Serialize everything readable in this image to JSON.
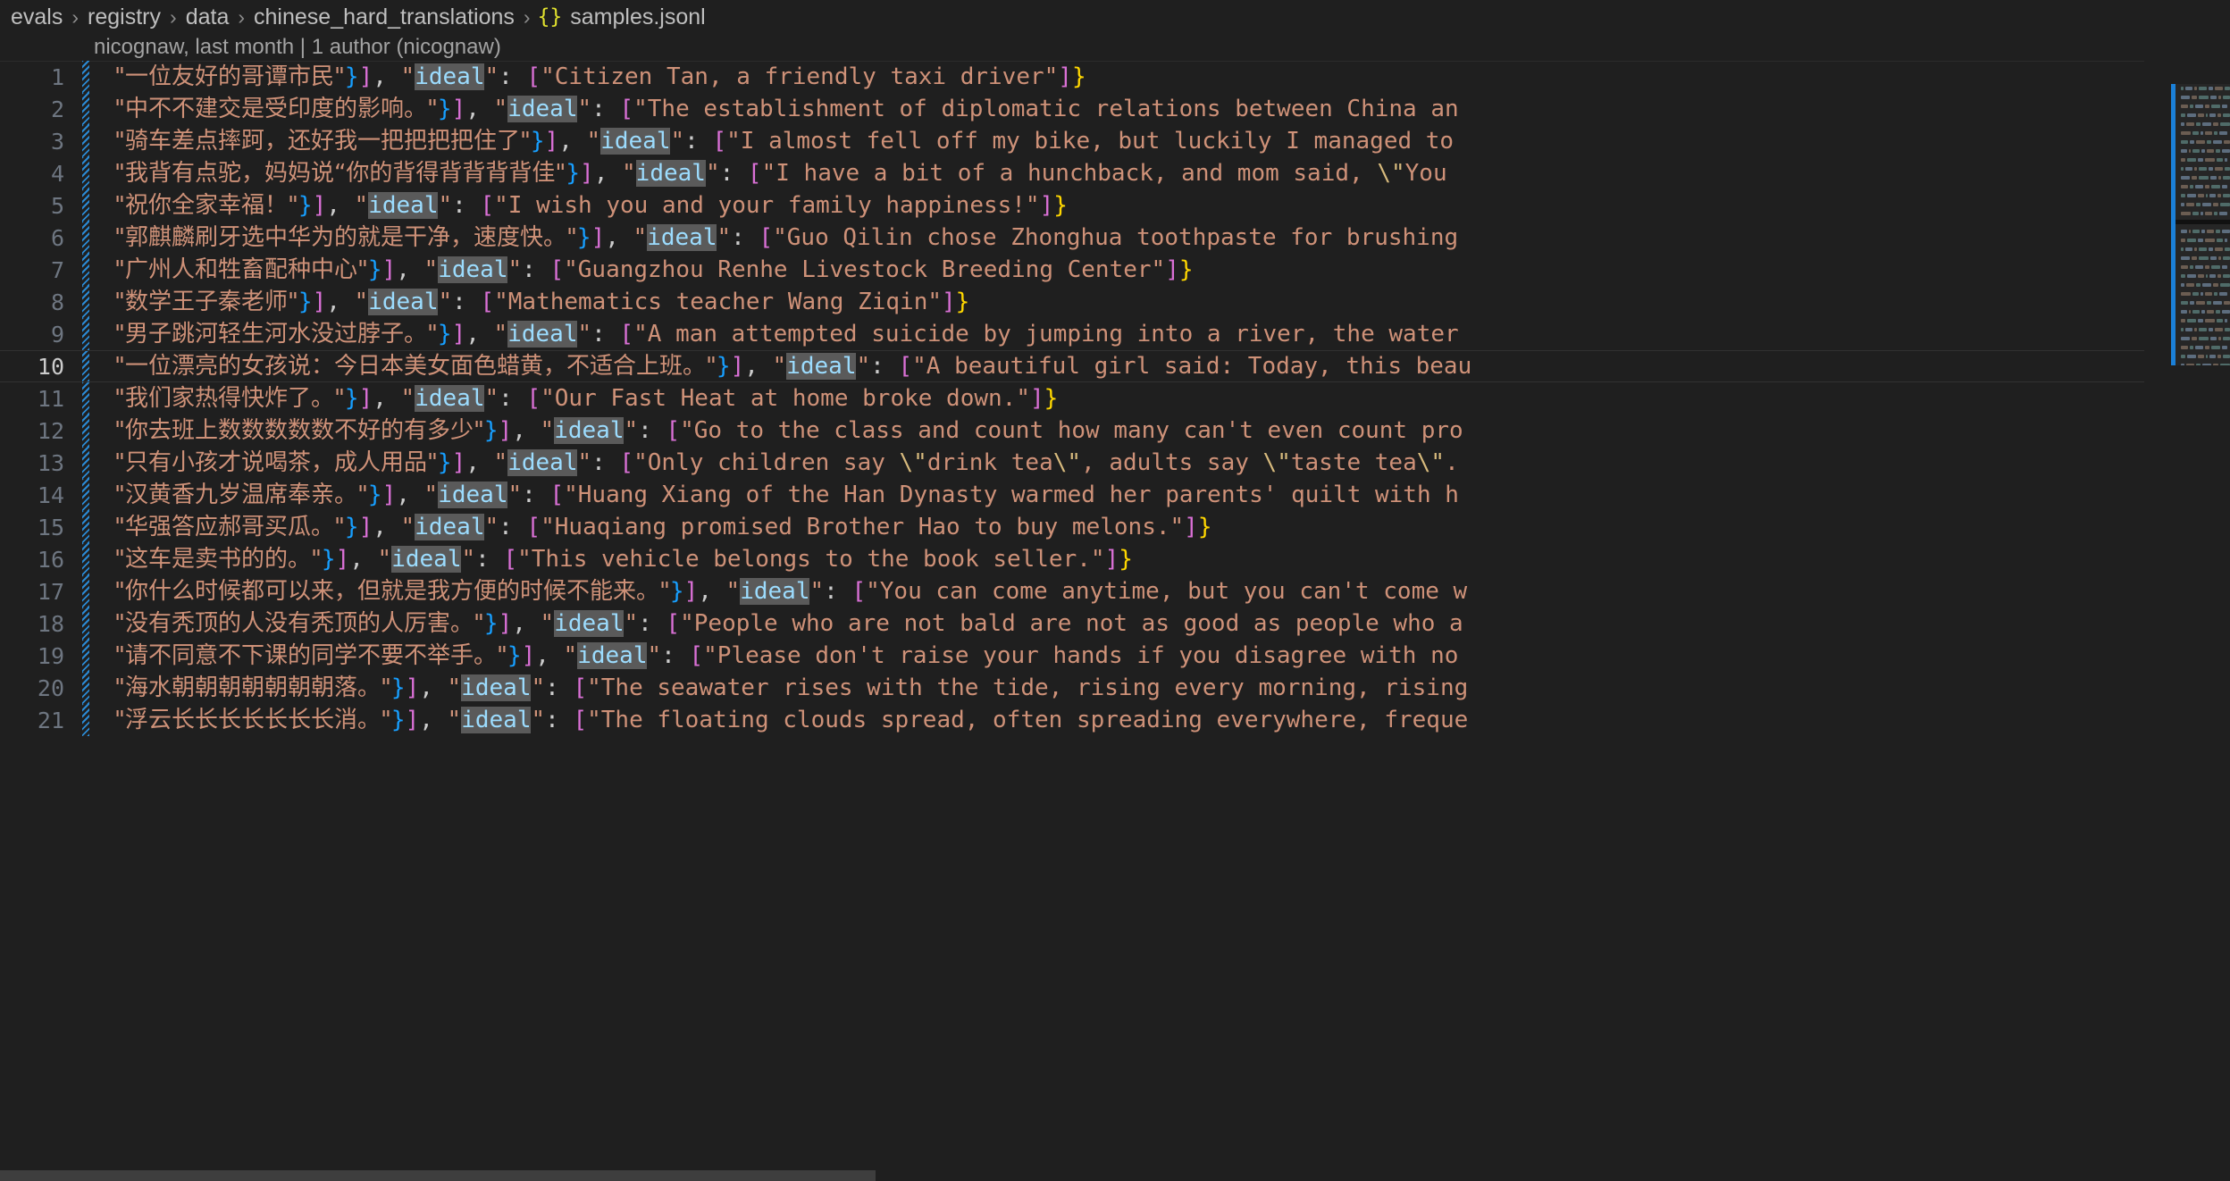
{
  "breadcrumb": {
    "separator": "›",
    "json_icon": "{}",
    "items": [
      "evals",
      "registry",
      "data",
      "chinese_hard_translations",
      "samples.jsonl"
    ]
  },
  "blame": {
    "text": "nicognaw, last month | 1 author (nicognaw)"
  },
  "search_term": "ideal",
  "colors": {
    "editor_background": "#1f1f1f",
    "string": "#ce9178",
    "escape": "#d7ba7d",
    "property_key": "#9cdcfe",
    "bracket_pink": "#da70d6",
    "bracket_blue": "#179fff",
    "bracket_yellow": "#ffd700",
    "line_number": "#6e7681",
    "active_line_number": "#cccccc",
    "find_match_highlight": "#5a5a5a",
    "git_added_gutter": "#2b8ad4",
    "breadcrumb_text": "#bfbfbf",
    "json_icon": "#e2e22e"
  },
  "editor": {
    "active_line": 10,
    "first_visible_line": 1,
    "last_visible_line": 21,
    "lines": [
      {
        "n": 1,
        "zh": "\"一位友好的哥谭市民\"",
        "en": "\"Citizen Tan, a friendly taxi driver\"",
        "close": "]}"
      },
      {
        "n": 2,
        "zh": "\"中不不建交是受印度的影响。\"",
        "en": "\"The establishment of diplomatic relations between China an",
        "close": ""
      },
      {
        "n": 3,
        "zh": "\"骑车差点摔跒，还好我一把把把把住了\"",
        "en": "\"I almost fell off my bike, but luckily I managed to",
        "close": ""
      },
      {
        "n": 4,
        "zh": "\"我背有点驼，妈妈说“你的背得背背背背佳\"",
        "en": "\"I have a bit of a hunchback, and mom said, \\\"You",
        "close": ""
      },
      {
        "n": 5,
        "zh": "\"祝你全家幸福！\"",
        "en": "\"I wish you and your family happiness!\"",
        "close": "]}"
      },
      {
        "n": 6,
        "zh": "\"郭麒麟刷牙选中华为的就是干净，速度快。\"",
        "en": "\"Guo Qilin chose Zhonghua toothpaste for brushing",
        "close": ""
      },
      {
        "n": 7,
        "zh": "\"广州人和牲畜配种中心\"",
        "en": "\"Guangzhou Renhe Livestock Breeding Center\"",
        "close": "]}"
      },
      {
        "n": 8,
        "zh": "\"数学王子秦老师\"",
        "en": "\"Mathematics teacher Wang Ziqin\"",
        "close": "]}"
      },
      {
        "n": 9,
        "zh": "\"男子跳河轻生河水没过脖子。\"",
        "en": "\"A man attempted suicide by jumping into a river, the water",
        "close": ""
      },
      {
        "n": 10,
        "zh": "\"一位漂亮的女孩说：今日本美女面色蜡黄，不适合上班。\"",
        "en": "\"A beautiful girl said: Today, this beau",
        "close": ""
      },
      {
        "n": 11,
        "zh": "\"我们家热得快炸了。\"",
        "en": "\"Our Fast Heat at home broke down.\"",
        "close": "]}"
      },
      {
        "n": 12,
        "zh": "\"你去班上数数数数数不好的有多少\"",
        "en": "\"Go to the class and count how many can't even count pro",
        "close": ""
      },
      {
        "n": 13,
        "zh": "\"只有小孩才说喝茶，成人用品\"",
        "en": "\"Only children say \\\"drink tea\\\", adults say \\\"taste tea\\\".",
        "close": ""
      },
      {
        "n": 14,
        "zh": "\"汉黄香九岁温席奉亲。\"",
        "en": "\"Huang Xiang of the Han Dynasty warmed her parents' quilt with h",
        "close": ""
      },
      {
        "n": 15,
        "zh": "\"华强答应郝哥买瓜。\"",
        "en": "\"Huaqiang promised Brother Hao to buy melons.\"",
        "close": "]}"
      },
      {
        "n": 16,
        "zh": "\"这车是卖书的的。\"",
        "en": "\"This vehicle belongs to the book seller.\"",
        "close": "]}"
      },
      {
        "n": 17,
        "zh": "\"你什么时候都可以来，但就是我方便的时候不能来。\"",
        "en": "\"You can come anytime, but you can't come w",
        "close": ""
      },
      {
        "n": 18,
        "zh": "\"没有秃顶的人没有秃顶的人厉害。\"",
        "en": "\"People who are not bald are not as good as people who a",
        "close": ""
      },
      {
        "n": 19,
        "zh": "\"请不同意不下课的同学不要不举手。\"",
        "en": "\"Please don't raise your hands if you disagree with no",
        "close": ""
      },
      {
        "n": 20,
        "zh": "\"海水朝朝朝朝朝朝朝落。\"",
        "en": "\"The seawater rises with the tide, rising every morning, rising",
        "close": ""
      },
      {
        "n": 21,
        "zh": "\"浮云长长长长长长长消。\"",
        "en": "\"The floating clouds spread, often spreading everywhere, freque",
        "close": ""
      }
    ]
  }
}
